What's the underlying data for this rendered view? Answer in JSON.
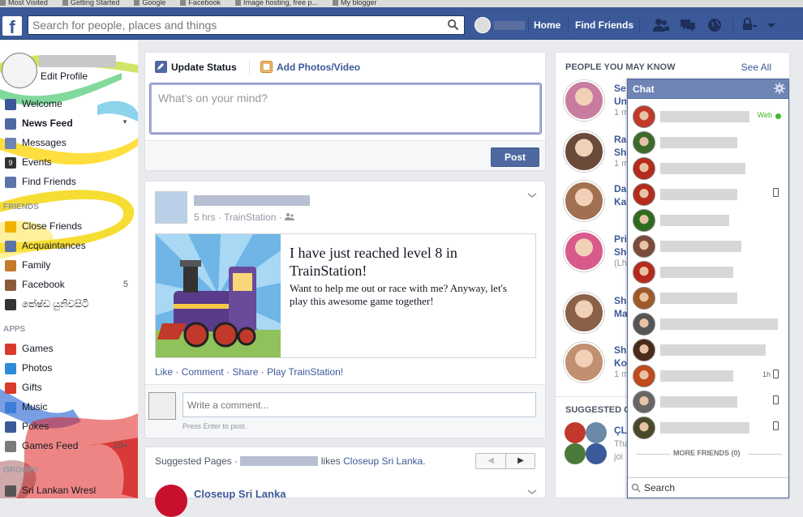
{
  "bookmarks": [
    "Most Visited",
    "Getting Started",
    "Google",
    "Facebook",
    "Image hosting, free p...",
    "My blogger"
  ],
  "topbar": {
    "logo": "f",
    "search_placeholder": "Search for people, places and things",
    "home": "Home",
    "find_friends": "Find Friends"
  },
  "left": {
    "edit_profile": "Edit Profile",
    "main": [
      {
        "label": "Welcome",
        "color": "#3b5998"
      },
      {
        "label": "News Feed",
        "color": "#4e69a2"
      },
      {
        "label": "Messages",
        "color": "#6d84b4"
      },
      {
        "label": "Events",
        "color": "#333333",
        "badge": "9"
      },
      {
        "label": "Find Friends",
        "color": "#5b74a8"
      }
    ],
    "friends_header": "FRIENDS",
    "friends": [
      {
        "label": "Close Friends",
        "color": "#f0b400"
      },
      {
        "label": "Acquaintances",
        "color": "#5b74a8"
      },
      {
        "label": "Family",
        "color": "#c47a2c"
      },
      {
        "label": "Facebook",
        "color": "#8b5a3c",
        "count": "5"
      },
      {
        "label": "කේෂ්ඩ යුනිවසිටි",
        "color": "#333333"
      }
    ],
    "apps_header": "APPS",
    "apps": [
      {
        "label": "Games",
        "color": "#d93a2b"
      },
      {
        "label": "Photos",
        "color": "#2e8bd8"
      },
      {
        "label": "Gifts",
        "color": "#d93a2b"
      },
      {
        "label": "Music",
        "color": "#3b7dd8"
      },
      {
        "label": "Pokes",
        "color": "#3b5998"
      },
      {
        "label": "Games Feed",
        "color": "#7a7a7a",
        "count": "20+"
      }
    ],
    "groups_header": "GROUPS",
    "groups": [
      {
        "label": "Sri Lankan Wresl",
        "color": "#555555"
      }
    ]
  },
  "composer": {
    "tab_status": "Update Status",
    "tab_photos": "Add Photos/Video",
    "placeholder": "What's on your mind?",
    "post": "Post"
  },
  "story": {
    "meta": "5 hrs · TrainStation ·",
    "title": "I have just reached level 8 in TrainStation!",
    "desc": "Want to help me out or race with me? Anyway, let's play this awesome game together!",
    "actions": {
      "like": "Like",
      "comment": "Comment",
      "share": "Share",
      "play": "Play TrainStation!"
    },
    "comment_placeholder": "Write a comment...",
    "press_enter": "Press Enter to post."
  },
  "suggested_pages": {
    "prefix": "Suggested Pages ·",
    "likes": "likes",
    "page_link": "Closeup Sri Lanka",
    "period": ".",
    "page_title": "Closeup Sri Lanka"
  },
  "pymk": {
    "title": "PEOPLE YOU MAY KNOW",
    "see_all": "See All",
    "people": [
      {
        "line1": "Se",
        "line2": "Un",
        "sub": "1 m",
        "color": "#c87ca0"
      },
      {
        "line1": "Ra",
        "line2": "Sh",
        "sub": "1 m",
        "color": "#6b4a3a"
      },
      {
        "line1": "Da",
        "line2": "Ka",
        "sub": "",
        "color": "#a07050"
      },
      {
        "line1": "Pri",
        "line2": "Sh",
        "sub": "(Lh",
        "color": "#d85a8a"
      },
      {
        "line1": "Sh",
        "line2": "Ma",
        "sub": "",
        "color": "#8a6048"
      },
      {
        "line1": "Sh",
        "line2": "Ko",
        "sub": "1 m",
        "color": "#c09070"
      }
    ],
    "suggested_groups": "SUGGESTED G",
    "group_name": "ÇL",
    "group_line2": "Tha",
    "group_line3": "joi"
  },
  "chat": {
    "title": "Chat",
    "web_label": "Web",
    "time_1h": "1h",
    "more_friends": "MORE FRIENDS (0)",
    "search_placeholder": "Search",
    "friends": [
      {
        "color": "#c0392b",
        "w": 110,
        "status": "web"
      },
      {
        "color": "#3a6b2a",
        "w": 95,
        "status": ""
      },
      {
        "color": "#b52a1c",
        "w": 105,
        "status": ""
      },
      {
        "color": "#b52a1c",
        "w": 95,
        "status": "mobile"
      },
      {
        "color": "#2e6b1f",
        "w": 85,
        "status": ""
      },
      {
        "color": "#7a4a3a",
        "w": 100,
        "status": ""
      },
      {
        "color": "#b52a1c",
        "w": 90,
        "status": ""
      },
      {
        "color": "#a05a2a",
        "w": 95,
        "status": ""
      },
      {
        "color": "#555555",
        "w": 145,
        "status": ""
      },
      {
        "color": "#4a2a1a",
        "w": 130,
        "status": ""
      },
      {
        "color": "#c04a1a",
        "w": 90,
        "status": "1h"
      },
      {
        "color": "#666666",
        "w": 95,
        "status": "mobile"
      },
      {
        "color": "#4a4a2a",
        "w": 110,
        "status": "mobile"
      }
    ]
  }
}
